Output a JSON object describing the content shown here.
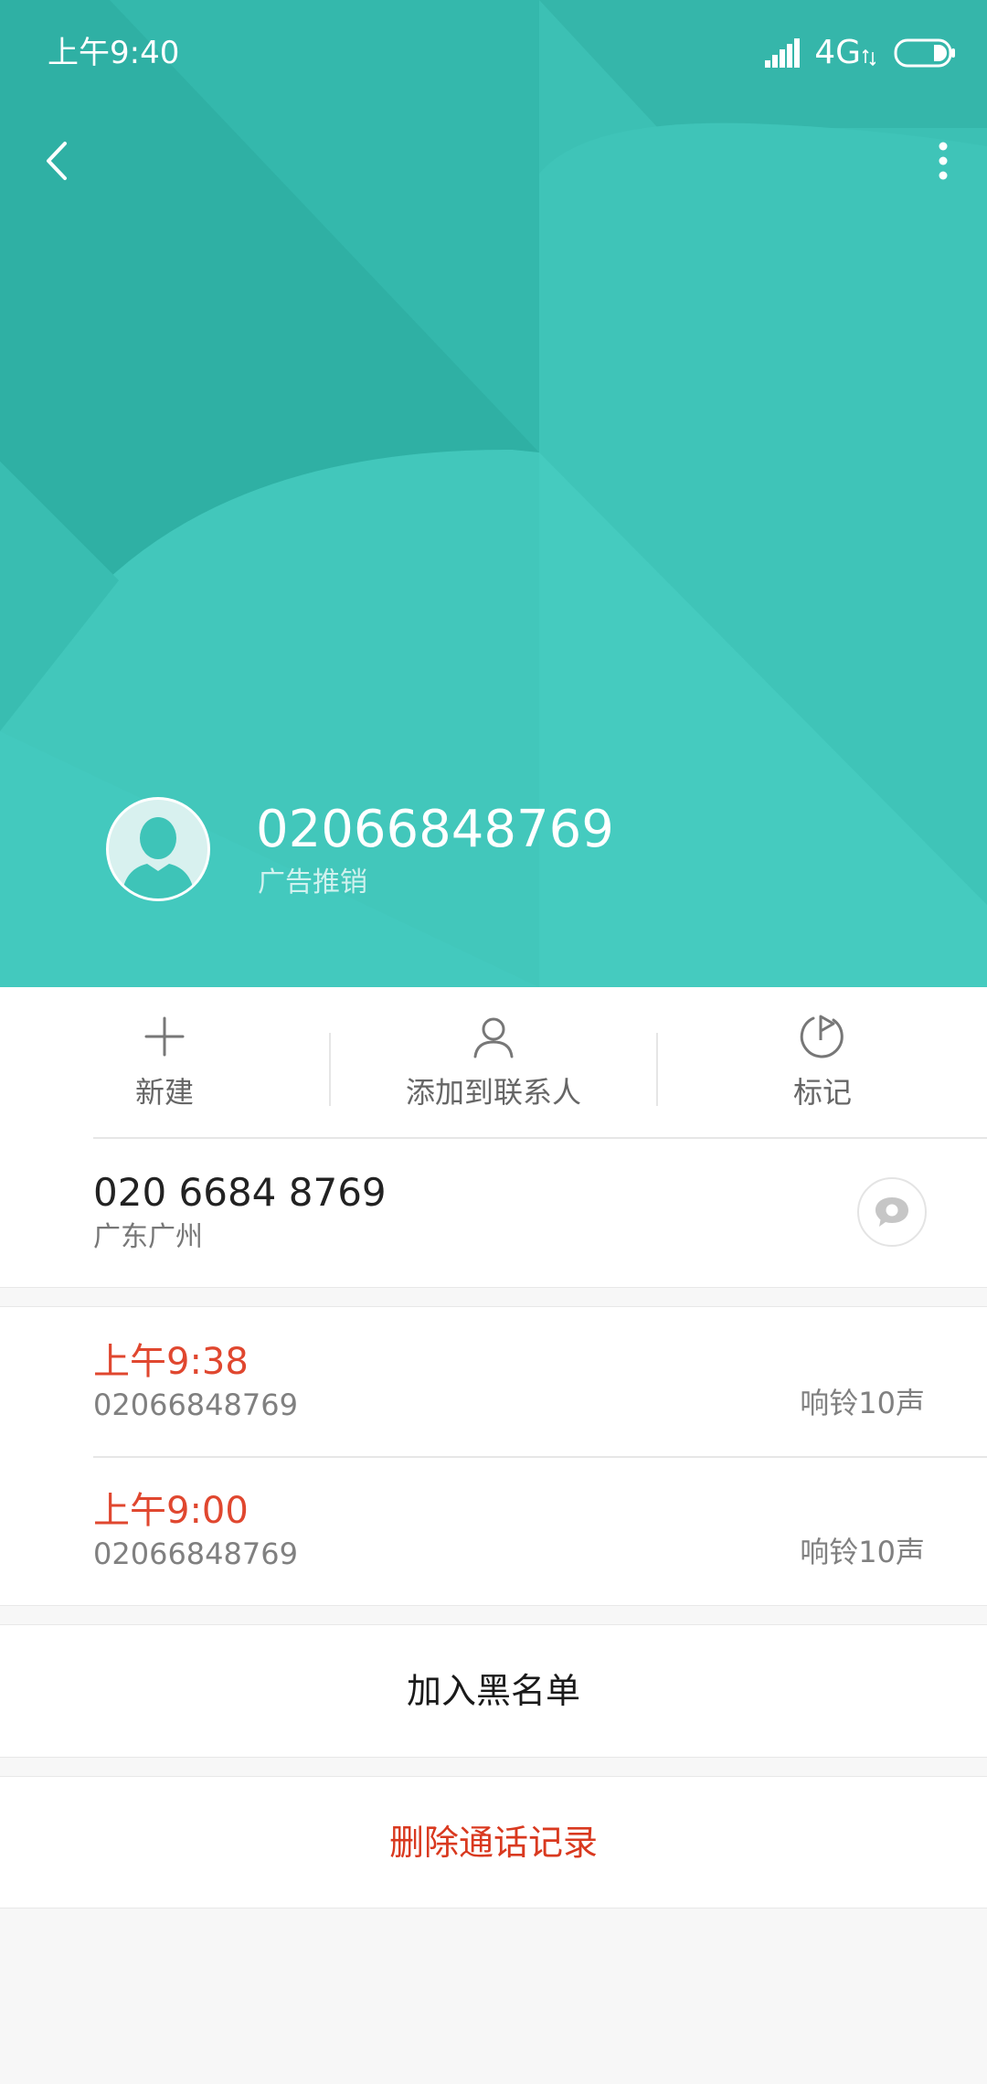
{
  "status_bar": {
    "time": "上午9:40",
    "network": "4G",
    "icons": [
      "signal-icon",
      "network-arrows-icon",
      "battery-icon"
    ]
  },
  "nav": {
    "back_icon": "chevron-left-icon",
    "more_icon": "more-vertical-icon"
  },
  "caller": {
    "number": "02066848769",
    "tag": "广告推销",
    "avatar_icon": "person-silhouette-icon"
  },
  "actions": [
    {
      "label": "新建",
      "icon": "plus-icon"
    },
    {
      "label": "添加到联系人",
      "icon": "person-icon"
    },
    {
      "label": "标记",
      "icon": "flag-icon"
    }
  ],
  "phone": {
    "number": "020 6684 8769",
    "location": "广东广州",
    "message_icon": "message-bubble-icon"
  },
  "call_history": [
    {
      "time": "上午9:38",
      "number": "02066848769",
      "detail": "响铃10声"
    },
    {
      "time": "上午9:00",
      "number": "02066848769",
      "detail": "响铃10声"
    }
  ],
  "buttons": {
    "block": "加入黑名单",
    "delete": "删除通话记录"
  },
  "colors": {
    "header_teal": "#3ec4b8",
    "missed_call_red": "#e0472f",
    "delete_red": "#d9391f"
  }
}
